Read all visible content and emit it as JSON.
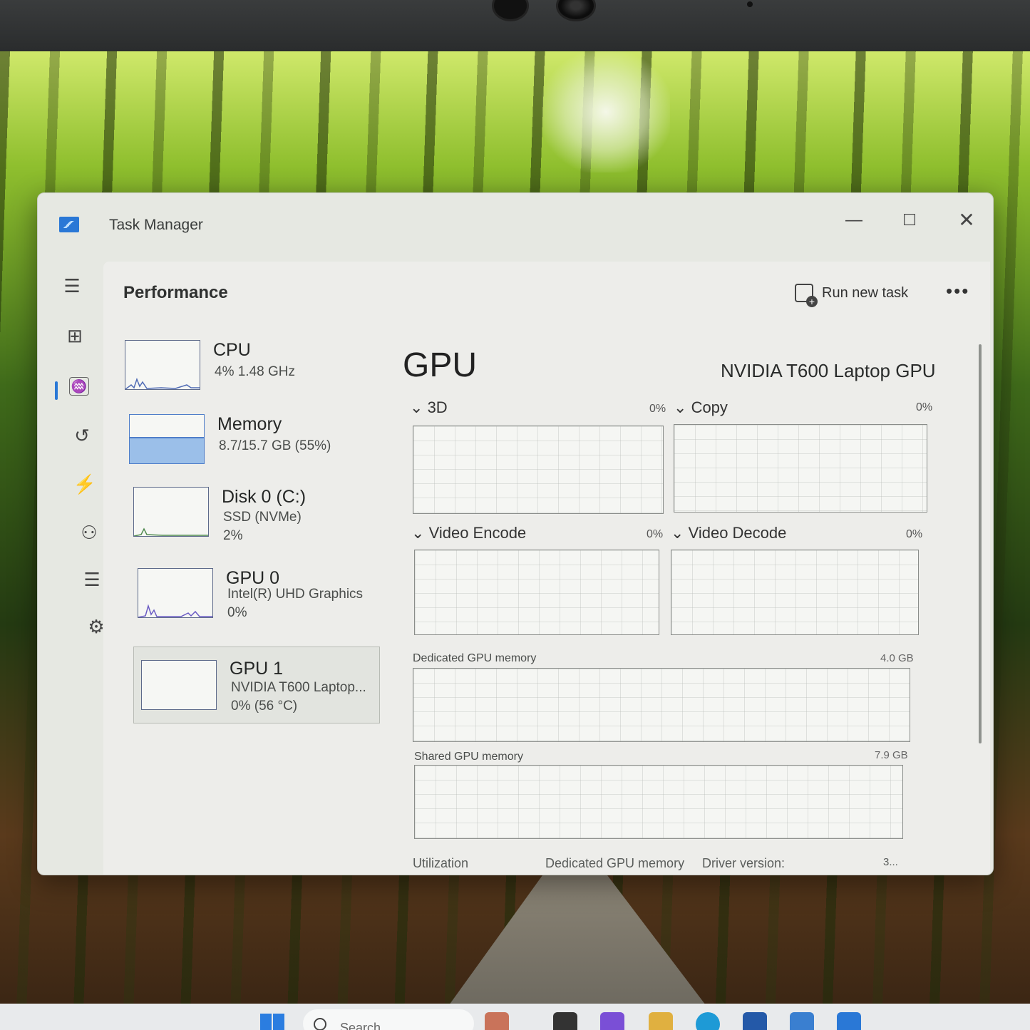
{
  "window": {
    "title": "Task Manager",
    "controls": {
      "minimize": "—",
      "maximize": "☐",
      "close": "✕"
    }
  },
  "nav": {
    "menu_icon": "hamburger-icon",
    "items": [
      {
        "icon": "processes-icon",
        "glyph": "⊞"
      },
      {
        "icon": "performance-icon",
        "glyph": "♒",
        "selected": true
      },
      {
        "icon": "app-history-icon",
        "glyph": "↺"
      },
      {
        "icon": "startup-apps-icon",
        "glyph": "⚡"
      },
      {
        "icon": "users-icon",
        "glyph": "⚇"
      },
      {
        "icon": "details-icon",
        "glyph": "☰"
      },
      {
        "icon": "services-icon",
        "glyph": "⚙"
      }
    ],
    "settings_icon": "⚙"
  },
  "header": {
    "title": "Performance",
    "run_new_task": "Run new task",
    "more": "•••"
  },
  "resources": [
    {
      "name": "CPU",
      "line1": "4%  1.48 GHz",
      "line2": "",
      "usage_fraction": 0.04
    },
    {
      "name": "Memory",
      "line1": "8.7/15.7 GB (55%)",
      "line2": "",
      "usage_fraction": 0.55
    },
    {
      "name": "Disk 0 (C:)",
      "line1": "SSD (NVMe)",
      "line2": "2%",
      "usage_fraction": 0.02
    },
    {
      "name": "GPU 0",
      "line1": "Intel(R) UHD Graphics",
      "line2": "0%",
      "usage_fraction": 0.0
    },
    {
      "name": "GPU 1",
      "line1": "NVIDIA T600 Laptop...",
      "line2": "0%  (56 °C)",
      "usage_fraction": 0.0,
      "selected": true
    }
  ],
  "detail": {
    "title": "GPU",
    "model": "NVIDIA T600 Laptop GPU",
    "engines": [
      {
        "label": "3D",
        "value": "0%"
      },
      {
        "label": "Copy",
        "value": "0%"
      },
      {
        "label": "Video Encode",
        "value": "0%"
      },
      {
        "label": "Video Decode",
        "value": "0%"
      }
    ],
    "dedicated_memory": {
      "label": "Dedicated GPU memory",
      "max": "4.0 GB"
    },
    "shared_memory": {
      "label": "Shared GPU memory",
      "max": "7.9 GB"
    },
    "footer": {
      "utilization": "Utilization",
      "dedicated": "Dedicated GPU memory",
      "driver": "Driver version:",
      "driver_value": "3..."
    }
  },
  "taskbar": {
    "search_placeholder": "Search"
  },
  "colors": {
    "accent": "#2a78d6",
    "memory_fill": "#9bbfe9",
    "graph_border": "#8a8d8a"
  }
}
